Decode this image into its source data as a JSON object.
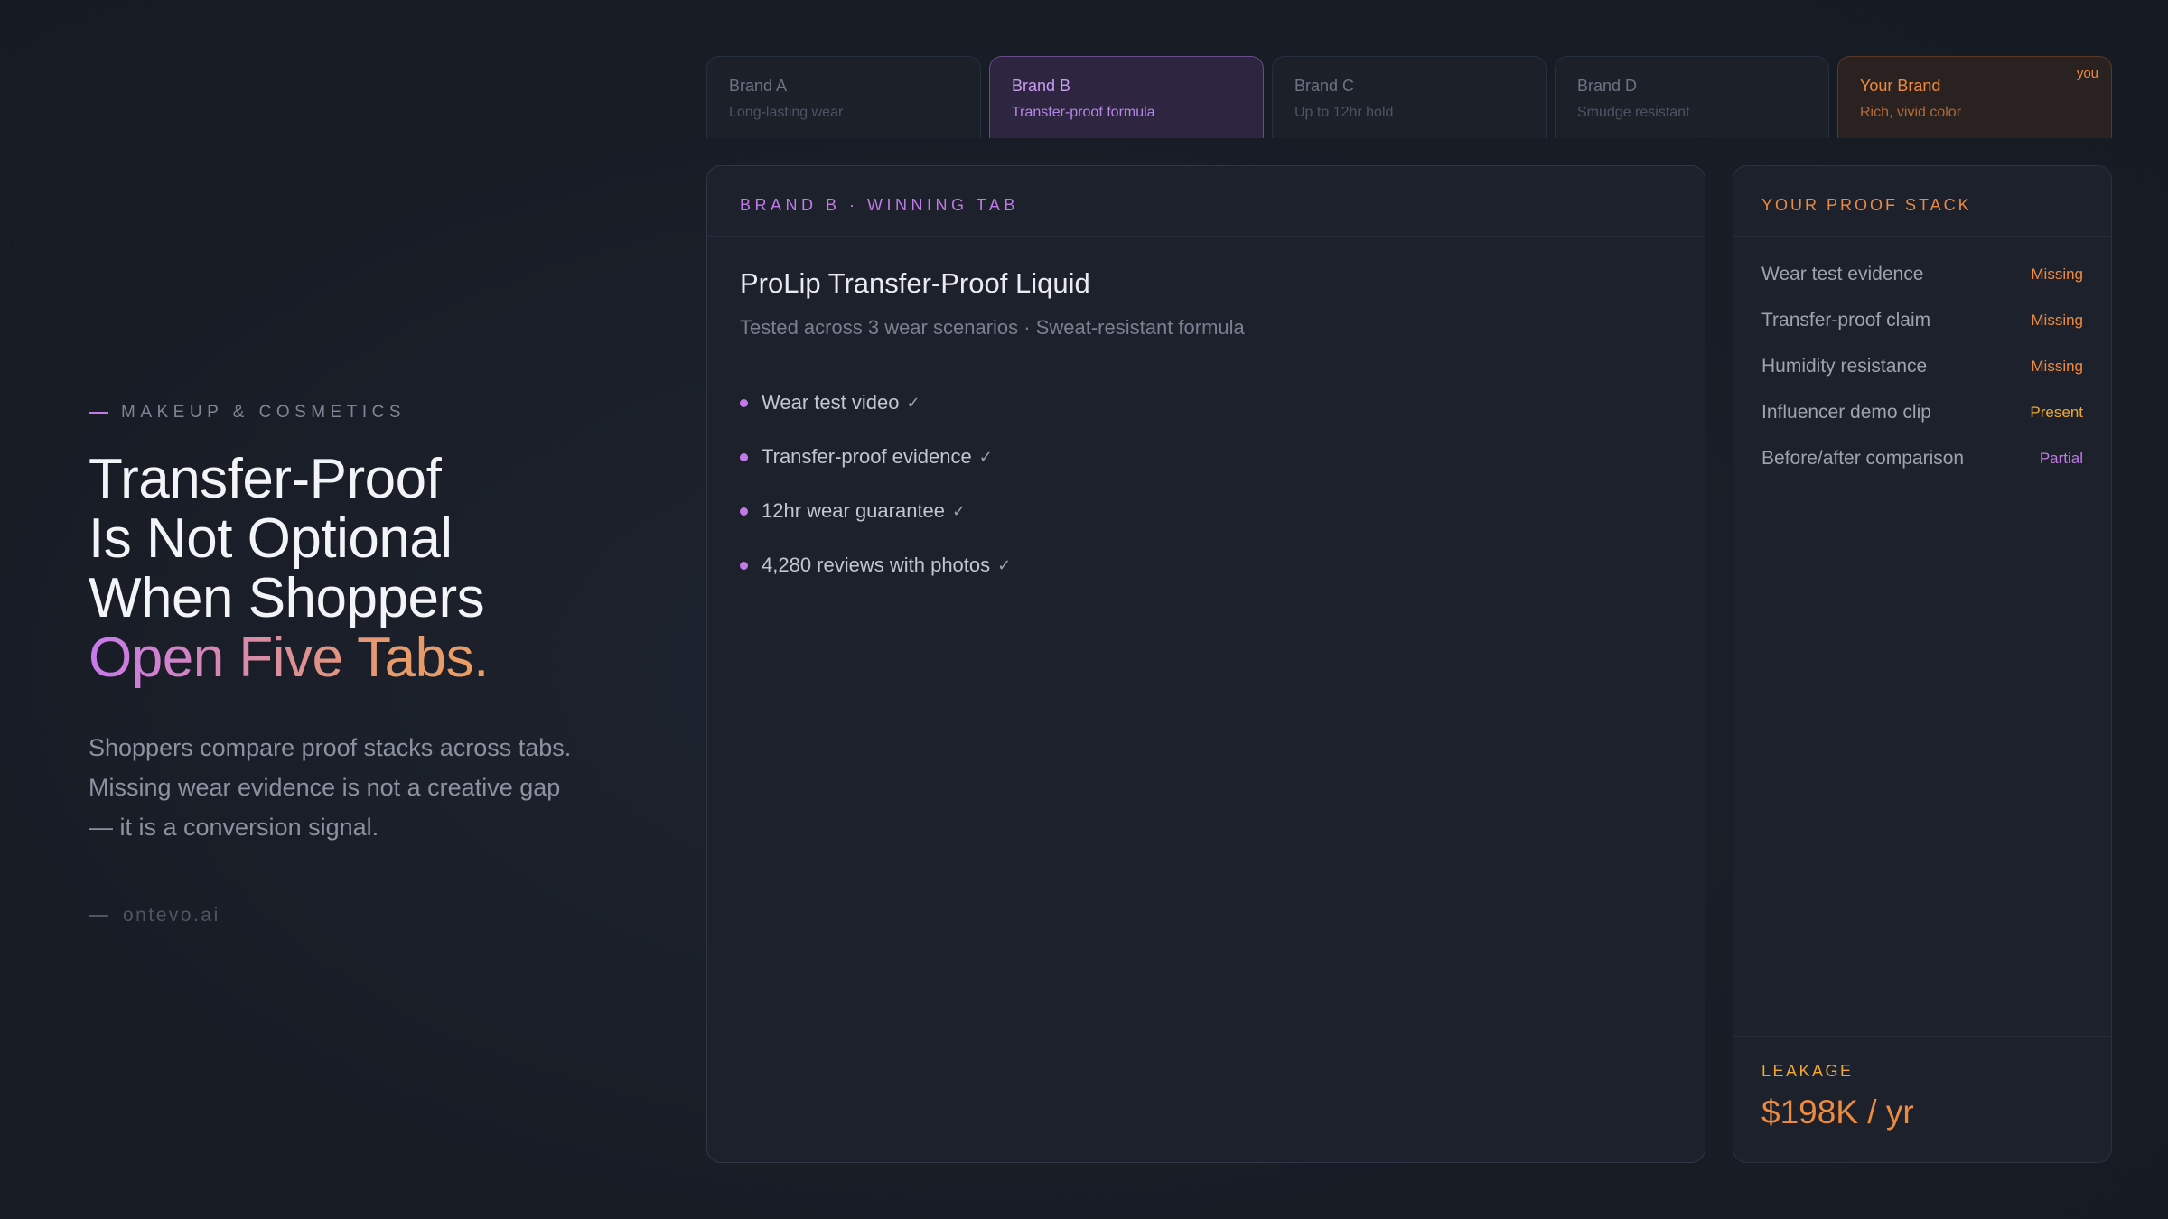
{
  "left": {
    "eyebrow": "MAKEUP & COSMETICS",
    "headline": [
      "Transfer-Proof",
      "Is Not Optional",
      "When Shoppers"
    ],
    "headline_accent": "Open Five Tabs.",
    "body": "Shoppers compare proof stacks across tabs. Missing wear evidence is not a creative gap — it is a conversion signal.",
    "signature": "ontevo.ai"
  },
  "tabs": [
    {
      "name": "Brand A",
      "sub": "Long-lasting wear"
    },
    {
      "name": "Brand B",
      "sub": "Transfer-proof formula"
    },
    {
      "name": "Brand C",
      "sub": "Up to 12hr hold"
    },
    {
      "name": "Brand D",
      "sub": "Smudge resistant"
    },
    {
      "name": "Your Brand",
      "sub": "Rich, vivid color",
      "badge": "you"
    }
  ],
  "main": {
    "header": "BRAND B · WINNING TAB",
    "product_title": "ProLip Transfer-Proof Liquid",
    "product_sub": "Tested across 3 wear scenarios · Sweat-resistant formula",
    "check_glyph": "✓",
    "checks": [
      "Wear test video",
      "Transfer-proof evidence",
      "12hr wear guarantee",
      "4,280 reviews with photos"
    ]
  },
  "side": {
    "header": "YOUR PROOF STACK",
    "items": [
      {
        "label": "Wear test evidence",
        "status": "Missing"
      },
      {
        "label": "Transfer-proof claim",
        "status": "Missing"
      },
      {
        "label": "Humidity resistance",
        "status": "Missing"
      },
      {
        "label": "Influencer demo clip",
        "status": "Present"
      },
      {
        "label": "Before/after comparison",
        "status": "Partial"
      }
    ],
    "leak_label": "LEAKAGE",
    "leak_value": "$198K / yr"
  },
  "colors": {
    "accent_purple": "#c17ae8",
    "accent_orange": "#ee8a3e",
    "accent_amber": "#f0a830",
    "background": "#181c25"
  }
}
